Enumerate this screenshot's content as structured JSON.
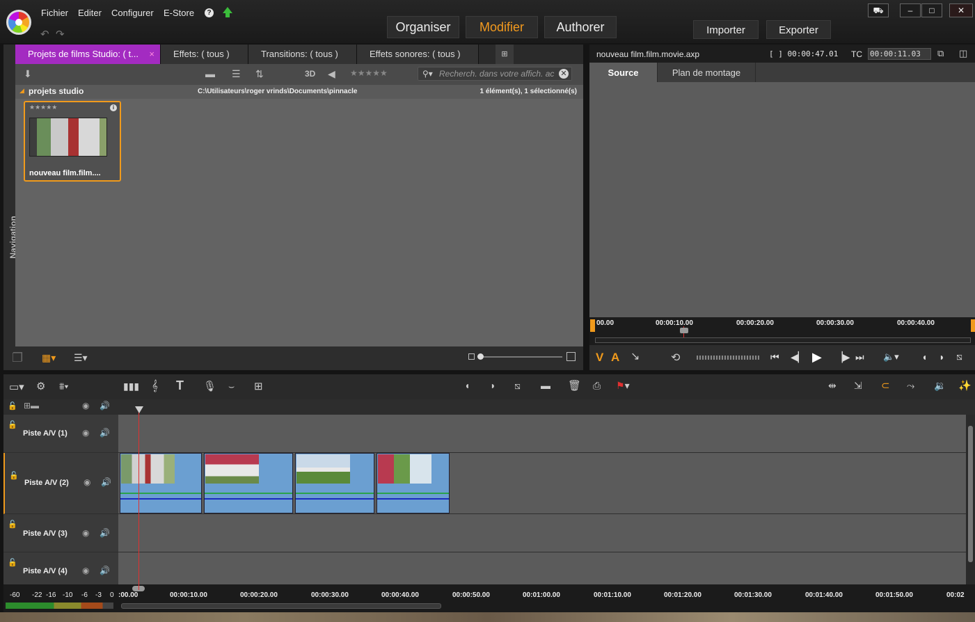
{
  "menu": {
    "items": [
      "Fichier",
      "Editer",
      "Configurer",
      "E-Store"
    ],
    "help": "?"
  },
  "modes": {
    "organiser": "Organiser",
    "modifier": "Modifier",
    "authorer": "Authorer"
  },
  "actions": {
    "importer": "Importer",
    "exporter": "Exporter"
  },
  "window_controls": {
    "minimize": "–",
    "maximize": "□",
    "close": "✕",
    "cart": "🛒"
  },
  "library": {
    "tabs": [
      {
        "label": "Projets de films Studio: ( t...",
        "close": "×"
      },
      {
        "label": "Effets: ( tous )"
      },
      {
        "label": "Transitions: ( tous )"
      },
      {
        "label": "Effets sonores: ( tous )"
      }
    ],
    "navigation_label": "Navigation",
    "toolbar": {
      "three_d": "3D",
      "rating": "★★★★★"
    },
    "search_placeholder": "Recherch. dans votre affich. ac",
    "folder_name": "projets studio",
    "path": "C:\\Utilisateurs\\roger vrinds\\Documents\\pinnacle",
    "selection_status": "1 élément(s), 1 sélectionné(s)",
    "item": {
      "stars": "★★★★★",
      "name": "nouveau film.film...."
    }
  },
  "player": {
    "file": "nouveau film.film.movie.axp",
    "duration": "[ ] 00:00:47.01",
    "tc_label": "TC",
    "timecode": "00:00:11.03",
    "tabs": {
      "source": "Source",
      "montage": "Plan de montage"
    },
    "ruler": [
      "00.00",
      "00:00:10.00",
      "00:00:20.00",
      "00:00:30.00",
      "00:00:40.00"
    ],
    "va": {
      "v": "V",
      "a": "A"
    }
  },
  "timeline": {
    "tracks": [
      "Piste A/V (1)",
      "Piste A/V (2)",
      "Piste A/V (3)",
      "Piste A/V (4)"
    ],
    "ruler": [
      ":00.00",
      "00:00:10.00",
      "00:00:20.00",
      "00:00:30.00",
      "00:00:40.00",
      "00:00:50.00",
      "00:01:00.00",
      "00:01:10.00",
      "00:01:20.00",
      "00:01:30.00",
      "00:01:40.00",
      "00:01:50.00",
      "00:02"
    ],
    "vu_scale": [
      "-60",
      "-22",
      "-16",
      "-10",
      "-6",
      "-3",
      "0"
    ],
    "clips": 4
  },
  "colors": {
    "accent": "#f39a1e",
    "tab_active": "#a32bc1",
    "clip": "#6b9fd1"
  }
}
